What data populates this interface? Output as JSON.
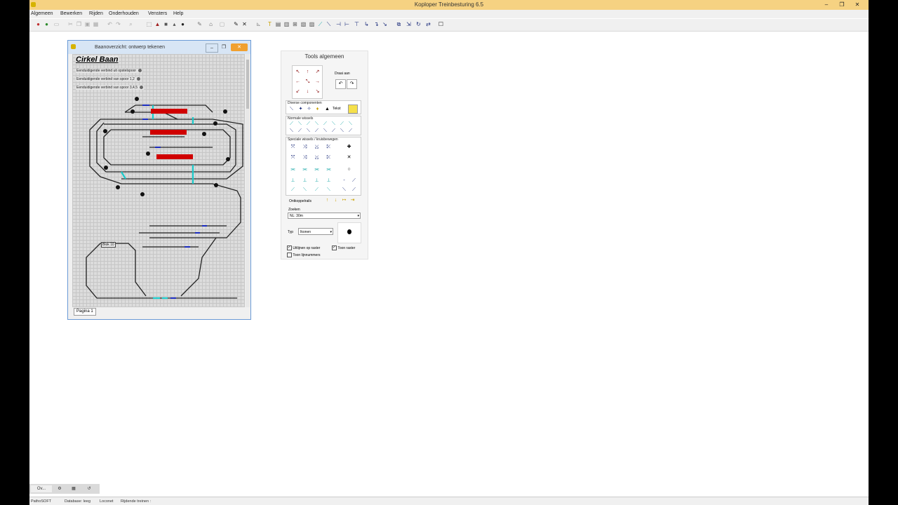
{
  "window": {
    "title": "Koploper Treinbesturing 6.5",
    "controls": {
      "minimize": "–",
      "maximize": "❐",
      "close": "✕"
    }
  },
  "menu": [
    "Algemeen",
    "Bewerken",
    "Rijden",
    "Onderhouden",
    "Vensters",
    "Help"
  ],
  "child_window": {
    "title": "Baanoverzicht: ontwerp tekenen",
    "heading": "Cirkel Baan",
    "routes": [
      "Eenduidigende verbind uit opstelspoor",
      "Eenduidigende verbind van spoor 1,2",
      "Eenduidigende verbind van spoor 3,4,5"
    ],
    "page_tab": "Pagina 1",
    "block_label": "Blok 10",
    "accent_color": "#d00000"
  },
  "tool_panel": {
    "title": "Tools algemeen",
    "draw_label": "Draai aan",
    "groups": {
      "divers": "Diverse componenten",
      "text_label": "Tekst",
      "normal_switches": "Normale wissels",
      "special_switches": "Speciale wissels / kruisbewegen",
      "decoupler": "Ontkoppelrails",
      "symbols": "Zoeken"
    },
    "font_value": "NL: 30m",
    "type_label": "Typ",
    "type_value": "Ikonen",
    "checkboxes": [
      {
        "label": "Uitlijnen op raster",
        "checked": true
      },
      {
        "label": "Toon raster",
        "checked": true
      },
      {
        "label": "Toon lijnnummers",
        "checked": false
      }
    ]
  },
  "task_tabs": [
    "Ov..."
  ],
  "statusbar": [
    "PathoSOFT",
    "Database: leeg",
    "Loconet",
    "Rijdende treinen : "
  ]
}
